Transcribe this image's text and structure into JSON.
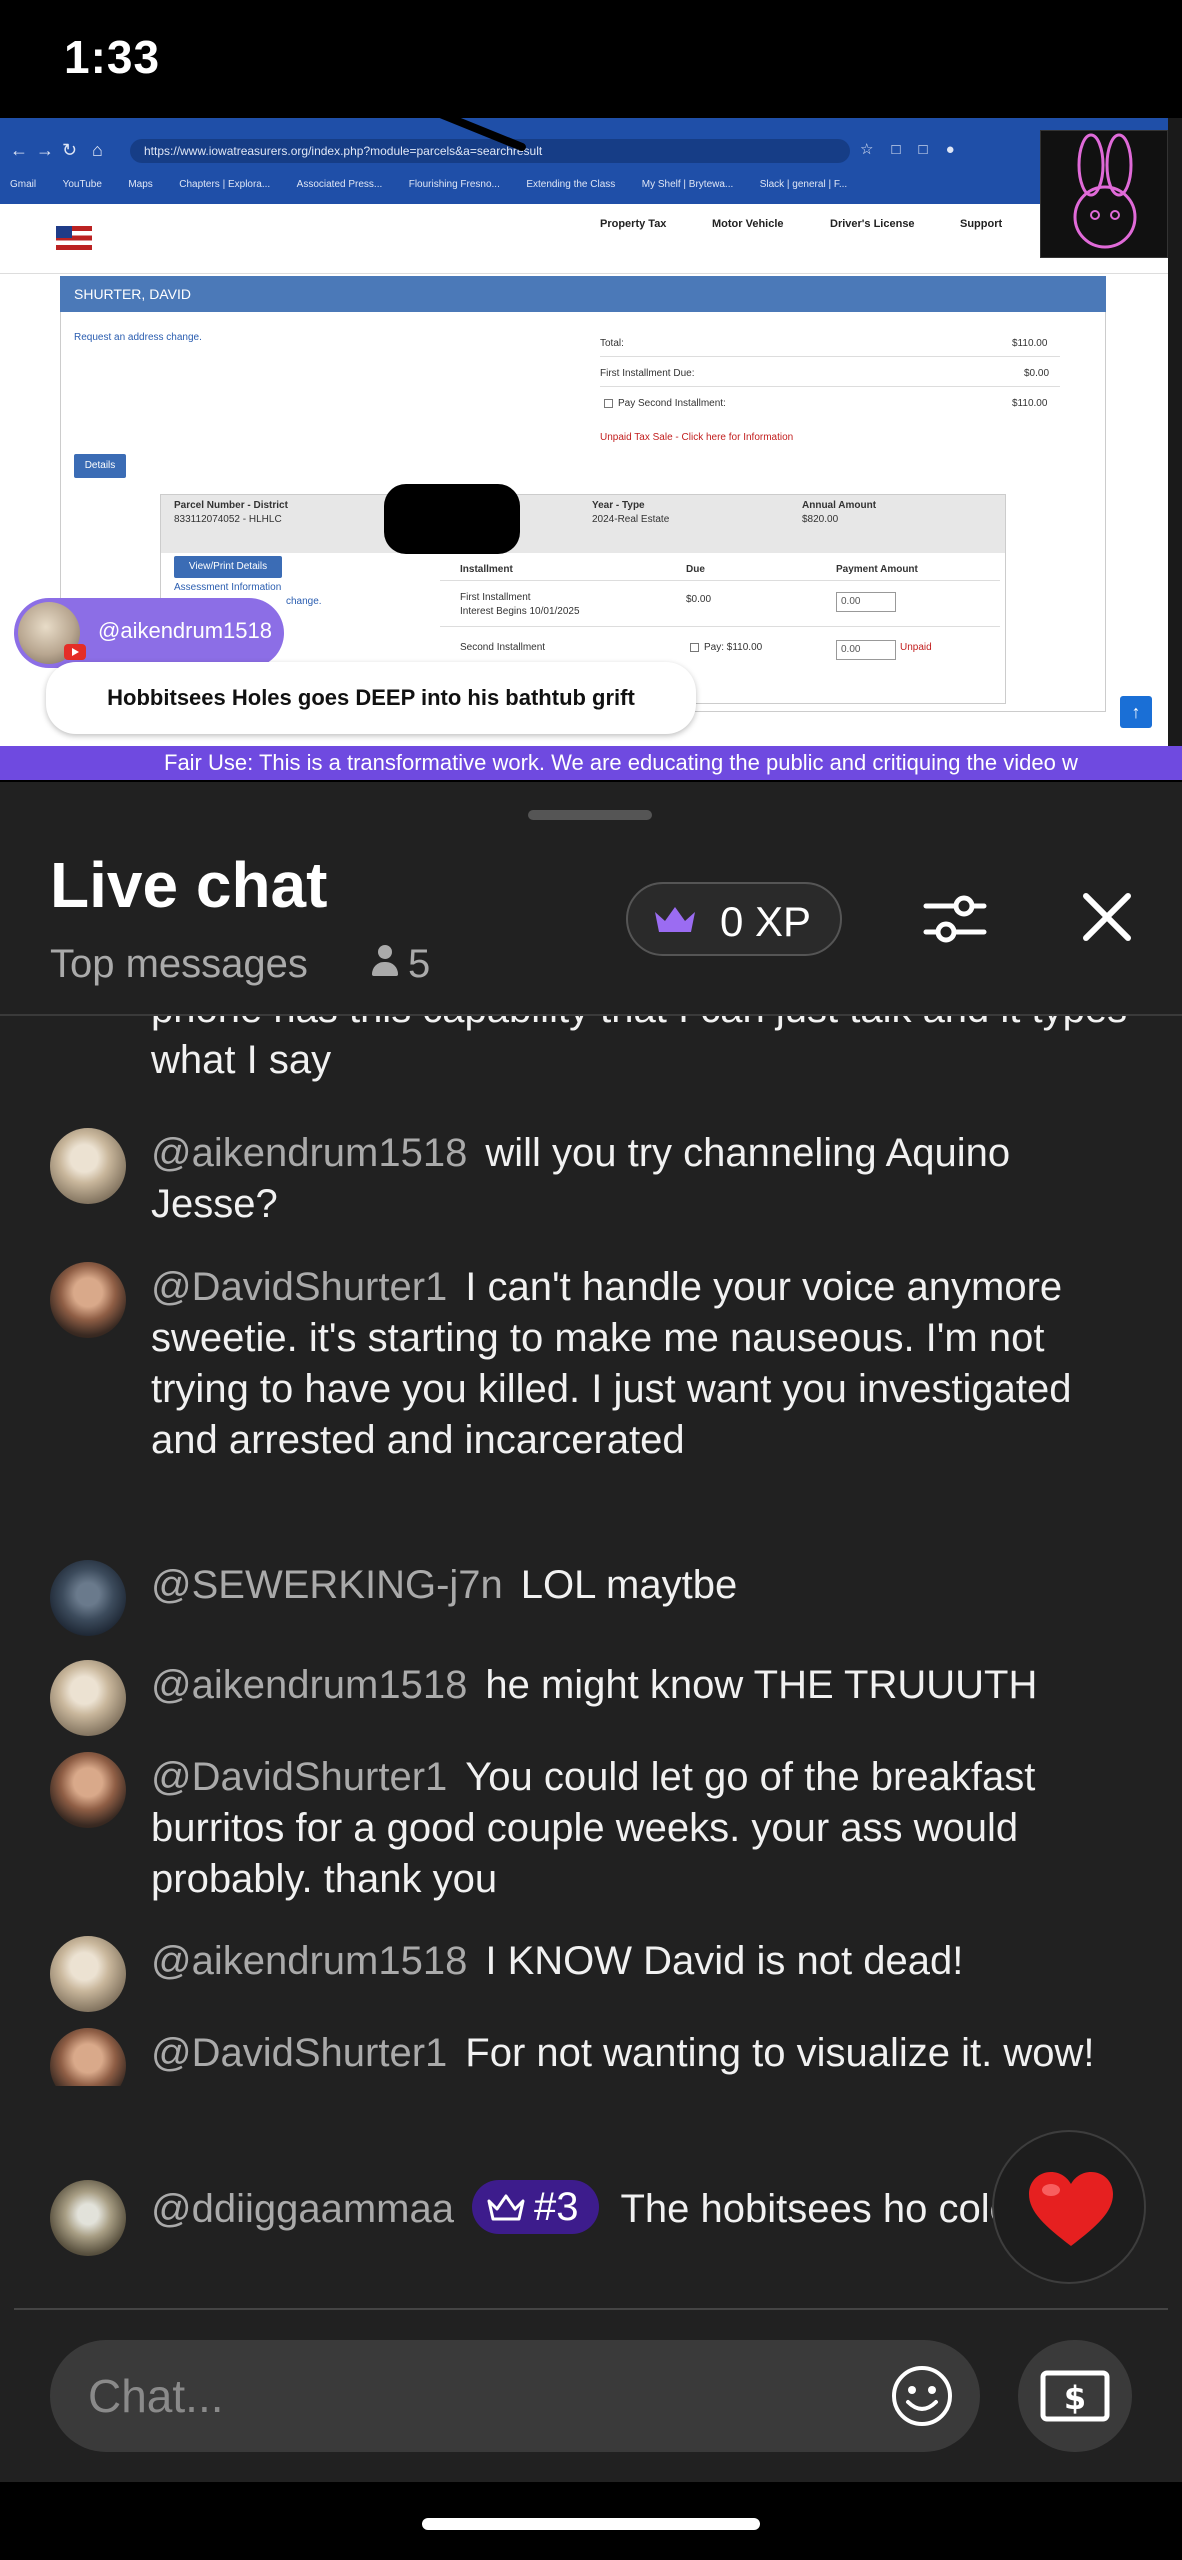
{
  "status_bar": {
    "time": "1:33"
  },
  "browser": {
    "url": "https://www.iowatreasurers.org/index.php?module=parcels&a=searchresult",
    "bookmarks": [
      "Gmail",
      "YouTube",
      "Maps",
      "Chapters | Explora...",
      "Associated Press...",
      "Flourishing Fresno...",
      "Extending the Class",
      "My Shelf | Brytewa...",
      "Slack | general | F..."
    ],
    "nav": [
      "Property Tax",
      "Motor Vehicle",
      "Driver's License",
      "Support"
    ]
  },
  "tax_page": {
    "owner_name": "SHURTER, DAVID",
    "address_change_link": "Request an address change.",
    "total_label": "Total:",
    "total_value": "$110.00",
    "first_due_label": "First Installment Due:",
    "first_due_value": "$0.00",
    "pay_second_label": "Pay Second Installment:",
    "pay_second_value": "$110.00",
    "tax_sale_link": "Unpaid Tax Sale - Click here for Information",
    "details_button": "Details",
    "parcel_label": "Parcel Number - District",
    "parcel_value": "833112074052 - HLHLC",
    "year_type_label": "Year - Type",
    "year_type_value": "2024-Real Estate",
    "annual_label": "Annual Amount",
    "annual_value": "$820.00",
    "print_button": "View/Print Details",
    "assessment_link": "Assessment Information",
    "change_link": "change.",
    "col_installment": "Installment",
    "col_due": "Due",
    "col_payment": "Payment Amount",
    "row1_name": "First Installment",
    "row1_interest": "Interest Begins 10/01/2025",
    "row1_due": "$0.00",
    "row1_amount": "0.00",
    "row2_name": "Second Installment",
    "row2_due": "Pay: $110.00",
    "row2_amount": "0.00",
    "row2_status": "Unpaid"
  },
  "video_overlay": {
    "tagged_user": "@aikendrum1518",
    "caption": "Hobbitsees Holes goes DEEP into his bathtub grift",
    "fair_use": "Fair Use: This is a transformative work. We are educating the public and critiquing the video w"
  },
  "chat": {
    "title": "Live chat",
    "filter": "Top messages",
    "viewer_count": "5",
    "xp": "0 XP",
    "partial_message": "phone has this capability that I can just talk and it types what I say",
    "messages": [
      {
        "author": "@aikendrum1518",
        "text": "will you try channeling Aquino Jesse?"
      },
      {
        "author": "@DavidShurter1",
        "text": "I can't handle your voice anymore sweetie. it's starting to make me nauseous. I'm not trying to have you killed. I just want you investigated and arrested and incarcerated"
      },
      {
        "author": "@SEWERKING-j7n",
        "text": "LOL maytbe"
      },
      {
        "author": "@aikendrum1518",
        "text": "he might know THE TRUUUTH"
      },
      {
        "author": "@DavidShurter1",
        "text": "You could let go of the breakfast burritos for a good couple weeks. your ass would probably. thank you"
      },
      {
        "author": "@aikendrum1518",
        "text": "I KNOW David is not dead!"
      },
      {
        "author": "@DavidShurter1",
        "text": "For not wanting to visualize it. wow! you certainly are describing it in detail"
      },
      {
        "author": "@ddiiggaammaa",
        "badge": "#3",
        "text": "The hobitsees ho colostrum"
      }
    ],
    "input_placeholder": "Chat..."
  },
  "colors": {
    "sheet_bg": "#212121",
    "author_gray": "#aaaaaa",
    "accent_purple": "#6f4ae0",
    "badge_purple": "#3d1c8c",
    "heart_red": "#e62020"
  }
}
